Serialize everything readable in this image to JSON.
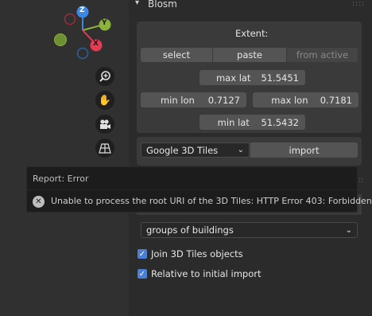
{
  "panel": {
    "title": "Blosm",
    "grip": "::::"
  },
  "extent": {
    "label": "Extent:",
    "select_label": "select",
    "paste_label": "paste",
    "from_active_label": "from active",
    "max_lat": {
      "label": "max lat",
      "value": "51.5451"
    },
    "min_lon": {
      "label": "min lon",
      "value": "0.7127"
    },
    "max_lon": {
      "label": "max lon",
      "value": "0.7181"
    },
    "min_lat": {
      "label": "min lat",
      "value": "51.5432"
    }
  },
  "source": {
    "selected": "Google 3D Tiles",
    "import_label": "import"
  },
  "buildings": {
    "selected": "groups of buildings"
  },
  "options": {
    "join_label": "Join 3D Tiles objects",
    "relative_label": "Relative to initial import"
  },
  "report": {
    "title": "Report: Error",
    "message": "Unable to process the root URI of the 3D Tiles: HTTP Error 403: Forbidden"
  },
  "gizmo": {
    "z": "Z",
    "y": "Y",
    "x": "X"
  },
  "colors": {
    "accent": "#4a7fd4",
    "x_axis": "#e83a52",
    "y_axis": "#8bb33b",
    "z_axis": "#3d86e6"
  },
  "icons": [
    "zoom-icon",
    "hand-icon",
    "camera-icon",
    "grid-icon",
    "error-icon",
    "chevron-down-icon",
    "check-icon"
  ]
}
